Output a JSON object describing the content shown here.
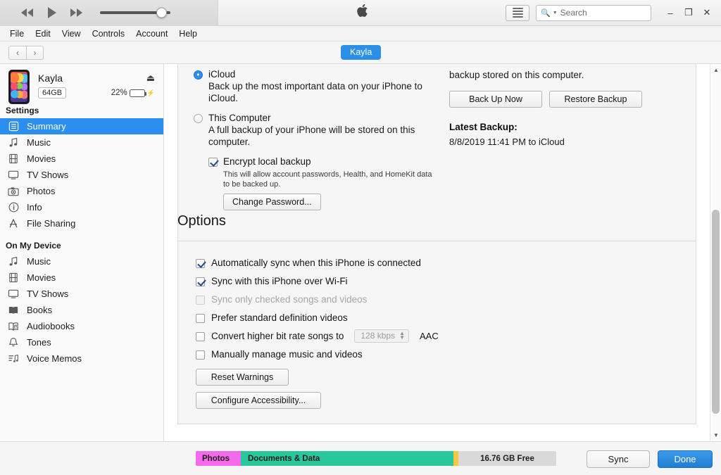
{
  "titlebar": {
    "transport": [
      {
        "name": "rewind-button",
        "icon": "rewind-icon"
      },
      {
        "name": "play-button",
        "icon": "play-icon"
      },
      {
        "name": "fast-forward-button",
        "icon": "fast-forward-icon"
      }
    ],
    "volume": {
      "label": "volume-slider",
      "value": 80
    },
    "apple_logo": "",
    "list_view_button": "list-view-icon",
    "search": {
      "placeholder": "Search",
      "value": "",
      "icon": "search-icon"
    },
    "window_buttons": {
      "minimize": "–",
      "maximize": "❐",
      "close": "✕"
    }
  },
  "menubar": {
    "items": [
      "File",
      "Edit",
      "View",
      "Controls",
      "Account",
      "Help"
    ]
  },
  "navbar": {
    "back": "‹",
    "forward": "›",
    "device_tab": "Kayla"
  },
  "sidebar": {
    "device": {
      "name": "Kayla",
      "capacity": "64GB",
      "battery_percent": "22%",
      "eject": "⏏",
      "charging_bolt": "⚡"
    },
    "sections": [
      {
        "title": "Settings",
        "items": [
          {
            "label": "Summary",
            "icon": "summary-icon",
            "active": true
          },
          {
            "label": "Music",
            "icon": "music-note-icon",
            "active": false
          },
          {
            "label": "Movies",
            "icon": "film-icon",
            "active": false
          },
          {
            "label": "TV Shows",
            "icon": "tv-icon",
            "active": false
          },
          {
            "label": "Photos",
            "icon": "camera-icon",
            "active": false
          },
          {
            "label": "Info",
            "icon": "info-circle-icon",
            "active": false
          },
          {
            "label": "File Sharing",
            "icon": "app-store-a-icon",
            "active": false
          }
        ]
      },
      {
        "title": "On My Device",
        "items": [
          {
            "label": "Music",
            "icon": "music-note-icon",
            "active": false
          },
          {
            "label": "Movies",
            "icon": "film-icon",
            "active": false
          },
          {
            "label": "TV Shows",
            "icon": "tv-icon",
            "active": false
          },
          {
            "label": "Books",
            "icon": "books-icon",
            "active": false
          },
          {
            "label": "Audiobooks",
            "icon": "audiobook-icon",
            "active": false
          },
          {
            "label": "Tones",
            "icon": "bell-icon",
            "active": false
          },
          {
            "label": "Voice Memos",
            "icon": "voice-memo-icon",
            "active": false
          }
        ]
      }
    ]
  },
  "backup": {
    "icloud": {
      "label": "iCloud",
      "selected": true,
      "description": "Back up the most important data on your iPhone to iCloud."
    },
    "this_computer": {
      "label": "This Computer",
      "selected": false,
      "description": "A full backup of your iPhone will be stored on this computer."
    },
    "encrypt": {
      "label": "Encrypt local backup",
      "checked": true,
      "hint": "This will allow account passwords, Health, and HomeKit data to be backed up."
    },
    "change_password_button": "Change Password...",
    "right_text": "backup stored on this computer.",
    "back_up_now_button": "Back Up Now",
    "restore_backup_button": "Restore Backup",
    "latest_backup_title": "Latest Backup:",
    "latest_backup_value": "8/8/2019 11:41 PM to iCloud"
  },
  "options": {
    "title": "Options",
    "checkboxes": [
      {
        "label": "Automatically sync when this iPhone is connected",
        "checked": true,
        "disabled": false
      },
      {
        "label": "Sync with this iPhone over Wi-Fi",
        "checked": true,
        "disabled": false
      },
      {
        "label": "Sync only checked songs and videos",
        "checked": false,
        "disabled": true
      },
      {
        "label": "Prefer standard definition videos",
        "checked": false,
        "disabled": false
      }
    ],
    "convert": {
      "label": "Convert higher bit rate songs to",
      "checked": false,
      "bitrate_value": "128 kbps",
      "codec": "AAC"
    },
    "manual": {
      "label": "Manually manage music and videos",
      "checked": false
    },
    "reset_warnings_button": "Reset Warnings",
    "configure_accessibility_button": "Configure Accessibility..."
  },
  "bottombar": {
    "capacity": [
      {
        "label": "Photos",
        "color": "#f36bea"
      },
      {
        "label": "Documents & Data",
        "color": "#2bc79c"
      },
      {
        "label": "",
        "color": "#f5c842"
      },
      {
        "label": "16.76 GB Free",
        "color": "#d9d9d9"
      }
    ],
    "sync_button": "Sync",
    "done_button": "Done"
  },
  "scrollbar": {
    "up": "▲",
    "down": "▼"
  }
}
